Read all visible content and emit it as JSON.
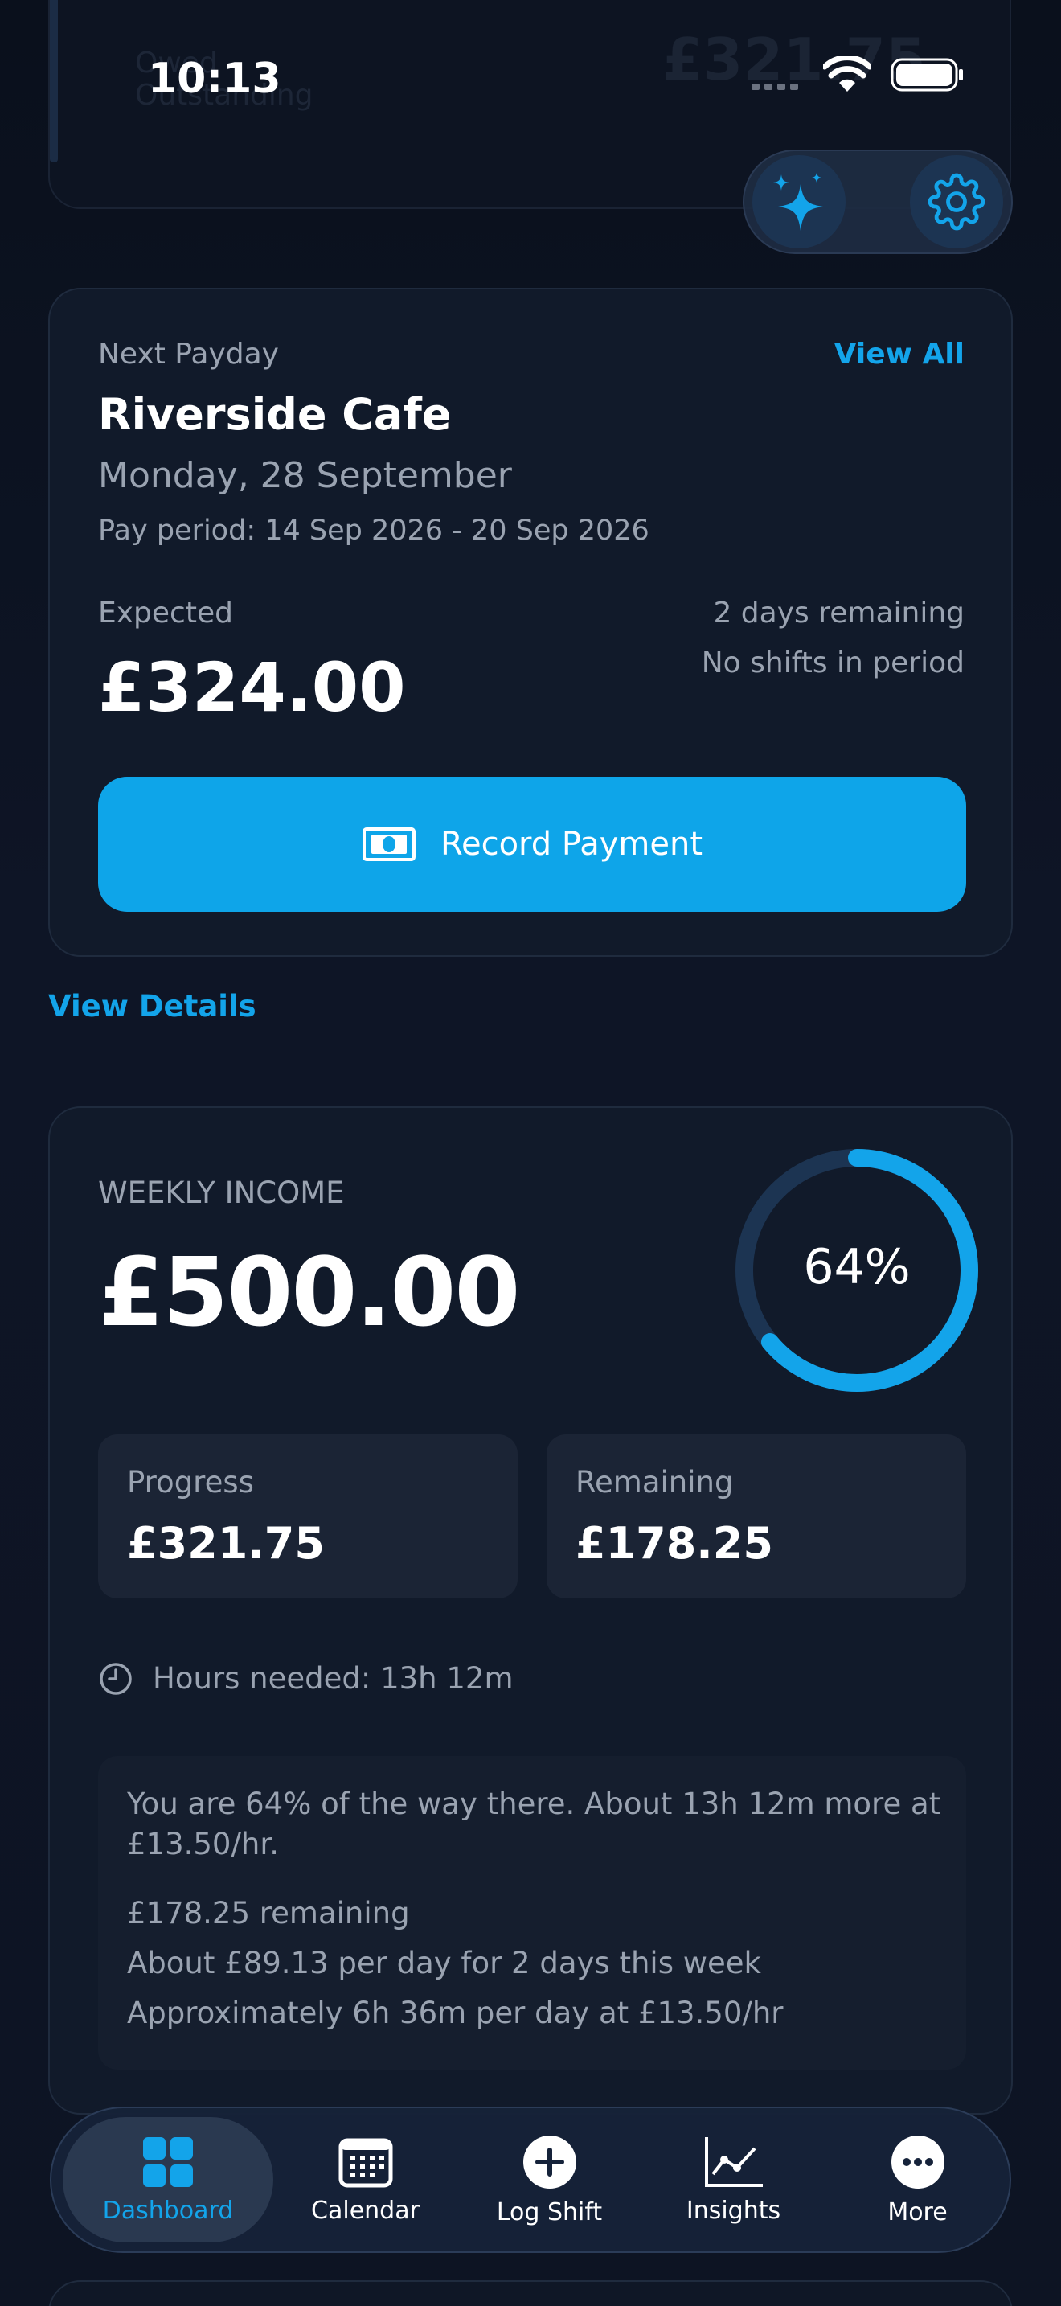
{
  "status_bar": {
    "time": "10:13"
  },
  "ghost_card": {
    "label_line1": "Owed",
    "label_line2": "Outstanding",
    "amount": "£321.75"
  },
  "payday": {
    "heading": "Next Payday",
    "view_all": "View All",
    "employer": "Riverside Cafe",
    "date": "Monday, 28 September",
    "period": "Pay period: 14 Sep 2026 - 20 Sep 2026",
    "expected_label": "Expected",
    "expected_amount": "£324.00",
    "days_remaining": "2 days remaining",
    "shifts_note": "No shifts in period",
    "record_button": "Record Payment"
  },
  "view_details": "View Details",
  "weekly": {
    "label": "WEEKLY INCOME",
    "amount": "£500.00",
    "progress_percent_text": "64%",
    "progress_fraction": 0.64,
    "progress_label": "Progress",
    "progress_value": "£321.75",
    "remaining_label": "Remaining",
    "remaining_value": "£178.25",
    "hours_needed": "Hours needed: 13h 12m",
    "info_line1": "You are 64% of the way there. About 13h 12m more at",
    "info_line2": "£13.50/hr.",
    "info_line3": "£178.25 remaining",
    "info_line4": "About £89.13 per day for 2 days this week",
    "info_line5": "Approximately 6h 36m per day at £13.50/hr"
  },
  "nav": {
    "items": [
      {
        "label": "Dashboard",
        "icon": "grid-icon"
      },
      {
        "label": "Calendar",
        "icon": "calendar-icon"
      },
      {
        "label": "Log Shift",
        "icon": "plus-circle-icon"
      },
      {
        "label": "Insights",
        "icon": "line-chart-icon"
      },
      {
        "label": "More",
        "icon": "more-icon"
      }
    ]
  },
  "colors": {
    "accent": "#13a4ea",
    "button": "#0ea5e9",
    "background": "#0c1220",
    "card": "#111a2a"
  }
}
